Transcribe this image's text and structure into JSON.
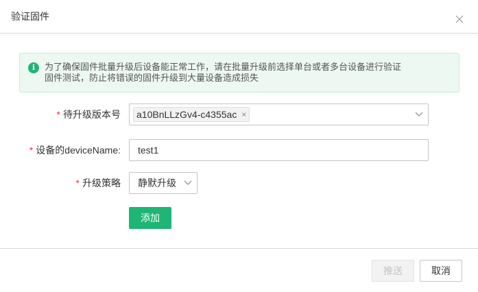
{
  "dialog": {
    "title": "验证固件",
    "close_icon": "close-icon"
  },
  "alert": {
    "icon": "info-icon",
    "icon_glyph": "i",
    "line1": "为了确保固件批量升级后设备能正常工作，请在批量升级前选择单台或者多台设备进行验证",
    "line2": "固件测试，防止将错误的固件升级到大量设备造成损失"
  },
  "form": {
    "required_mark": "*",
    "version_label": "待升级版本号",
    "version_tag": "a10BnLLzGv4-c4355ac",
    "tag_remove": "×",
    "device_label": "设备的deviceName:",
    "device_value": "test1",
    "strategy_label": "升级策略",
    "strategy_value": "静默升级",
    "add_button": "添加"
  },
  "footer": {
    "push_button": "推送",
    "cancel_button": "取消"
  },
  "colors": {
    "primary": "#1fb575",
    "required": "#e4393c",
    "alert_bg": "#ecf8f1"
  }
}
